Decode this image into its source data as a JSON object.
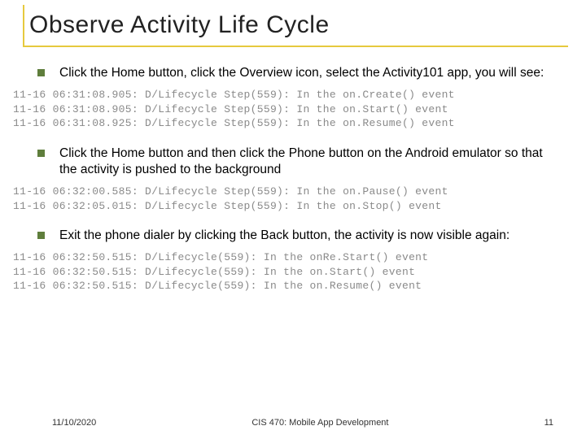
{
  "title": "Observe Activity Life Cycle",
  "bullets": {
    "b1": "Click the Home button, click the Overview icon, select the Activity101 app, you will see:",
    "b2": "Click the Home button and then click the Phone button on the Android emulator so that the activity is pushed to the background",
    "b3": "Exit the phone dialer by clicking the Back button, the activity is now visible again:"
  },
  "logs": {
    "log1": "11-16 06:31:08.905: D/Lifecycle Step(559): In the on.Create() event\n11-16 06:31:08.905: D/Lifecycle Step(559): In the on.Start() event\n11-16 06:31:08.925: D/Lifecycle Step(559): In the on.Resume() event",
    "log2": "11-16 06:32:00.585: D/Lifecycle Step(559): In the on.Pause() event\n11-16 06:32:05.015: D/Lifecycle Step(559): In the on.Stop() event",
    "log3": "11-16 06:32:50.515: D/Lifecycle(559): In the onRe.Start() event\n11-16 06:32:50.515: D/Lifecycle(559): In the on.Start() event\n11-16 06:32:50.515: D/Lifecycle(559): In the on.Resume() event"
  },
  "footer": {
    "date": "11/10/2020",
    "course": "CIS 470: Mobile App Development",
    "page": "11"
  }
}
